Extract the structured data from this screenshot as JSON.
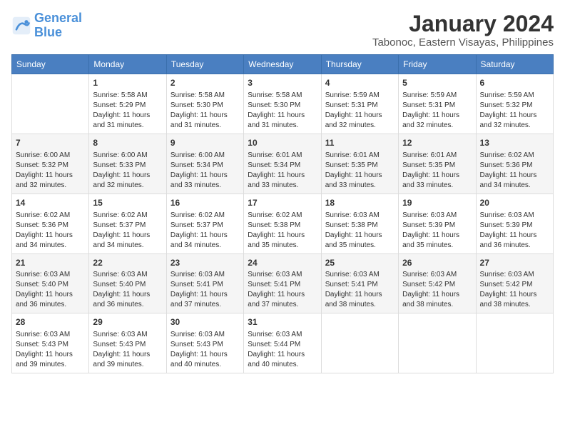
{
  "logo": {
    "general": "General",
    "blue": "Blue"
  },
  "title": "January 2024",
  "subtitle": "Tabonoc, Eastern Visayas, Philippines",
  "days_of_week": [
    "Sunday",
    "Monday",
    "Tuesday",
    "Wednesday",
    "Thursday",
    "Friday",
    "Saturday"
  ],
  "weeks": [
    [
      {
        "day": "",
        "info": ""
      },
      {
        "day": "1",
        "info": "Sunrise: 5:58 AM\nSunset: 5:29 PM\nDaylight: 11 hours\nand 31 minutes."
      },
      {
        "day": "2",
        "info": "Sunrise: 5:58 AM\nSunset: 5:30 PM\nDaylight: 11 hours\nand 31 minutes."
      },
      {
        "day": "3",
        "info": "Sunrise: 5:58 AM\nSunset: 5:30 PM\nDaylight: 11 hours\nand 31 minutes."
      },
      {
        "day": "4",
        "info": "Sunrise: 5:59 AM\nSunset: 5:31 PM\nDaylight: 11 hours\nand 32 minutes."
      },
      {
        "day": "5",
        "info": "Sunrise: 5:59 AM\nSunset: 5:31 PM\nDaylight: 11 hours\nand 32 minutes."
      },
      {
        "day": "6",
        "info": "Sunrise: 5:59 AM\nSunset: 5:32 PM\nDaylight: 11 hours\nand 32 minutes."
      }
    ],
    [
      {
        "day": "7",
        "info": "Sunrise: 6:00 AM\nSunset: 5:32 PM\nDaylight: 11 hours\nand 32 minutes."
      },
      {
        "day": "8",
        "info": "Sunrise: 6:00 AM\nSunset: 5:33 PM\nDaylight: 11 hours\nand 32 minutes."
      },
      {
        "day": "9",
        "info": "Sunrise: 6:00 AM\nSunset: 5:34 PM\nDaylight: 11 hours\nand 33 minutes."
      },
      {
        "day": "10",
        "info": "Sunrise: 6:01 AM\nSunset: 5:34 PM\nDaylight: 11 hours\nand 33 minutes."
      },
      {
        "day": "11",
        "info": "Sunrise: 6:01 AM\nSunset: 5:35 PM\nDaylight: 11 hours\nand 33 minutes."
      },
      {
        "day": "12",
        "info": "Sunrise: 6:01 AM\nSunset: 5:35 PM\nDaylight: 11 hours\nand 33 minutes."
      },
      {
        "day": "13",
        "info": "Sunrise: 6:02 AM\nSunset: 5:36 PM\nDaylight: 11 hours\nand 34 minutes."
      }
    ],
    [
      {
        "day": "14",
        "info": "Sunrise: 6:02 AM\nSunset: 5:36 PM\nDaylight: 11 hours\nand 34 minutes."
      },
      {
        "day": "15",
        "info": "Sunrise: 6:02 AM\nSunset: 5:37 PM\nDaylight: 11 hours\nand 34 minutes."
      },
      {
        "day": "16",
        "info": "Sunrise: 6:02 AM\nSunset: 5:37 PM\nDaylight: 11 hours\nand 34 minutes."
      },
      {
        "day": "17",
        "info": "Sunrise: 6:02 AM\nSunset: 5:38 PM\nDaylight: 11 hours\nand 35 minutes."
      },
      {
        "day": "18",
        "info": "Sunrise: 6:03 AM\nSunset: 5:38 PM\nDaylight: 11 hours\nand 35 minutes."
      },
      {
        "day": "19",
        "info": "Sunrise: 6:03 AM\nSunset: 5:39 PM\nDaylight: 11 hours\nand 35 minutes."
      },
      {
        "day": "20",
        "info": "Sunrise: 6:03 AM\nSunset: 5:39 PM\nDaylight: 11 hours\nand 36 minutes."
      }
    ],
    [
      {
        "day": "21",
        "info": "Sunrise: 6:03 AM\nSunset: 5:40 PM\nDaylight: 11 hours\nand 36 minutes."
      },
      {
        "day": "22",
        "info": "Sunrise: 6:03 AM\nSunset: 5:40 PM\nDaylight: 11 hours\nand 36 minutes."
      },
      {
        "day": "23",
        "info": "Sunrise: 6:03 AM\nSunset: 5:41 PM\nDaylight: 11 hours\nand 37 minutes."
      },
      {
        "day": "24",
        "info": "Sunrise: 6:03 AM\nSunset: 5:41 PM\nDaylight: 11 hours\nand 37 minutes."
      },
      {
        "day": "25",
        "info": "Sunrise: 6:03 AM\nSunset: 5:41 PM\nDaylight: 11 hours\nand 38 minutes."
      },
      {
        "day": "26",
        "info": "Sunrise: 6:03 AM\nSunset: 5:42 PM\nDaylight: 11 hours\nand 38 minutes."
      },
      {
        "day": "27",
        "info": "Sunrise: 6:03 AM\nSunset: 5:42 PM\nDaylight: 11 hours\nand 38 minutes."
      }
    ],
    [
      {
        "day": "28",
        "info": "Sunrise: 6:03 AM\nSunset: 5:43 PM\nDaylight: 11 hours\nand 39 minutes."
      },
      {
        "day": "29",
        "info": "Sunrise: 6:03 AM\nSunset: 5:43 PM\nDaylight: 11 hours\nand 39 minutes."
      },
      {
        "day": "30",
        "info": "Sunrise: 6:03 AM\nSunset: 5:43 PM\nDaylight: 11 hours\nand 40 minutes."
      },
      {
        "day": "31",
        "info": "Sunrise: 6:03 AM\nSunset: 5:44 PM\nDaylight: 11 hours\nand 40 minutes."
      },
      {
        "day": "",
        "info": ""
      },
      {
        "day": "",
        "info": ""
      },
      {
        "day": "",
        "info": ""
      }
    ]
  ]
}
